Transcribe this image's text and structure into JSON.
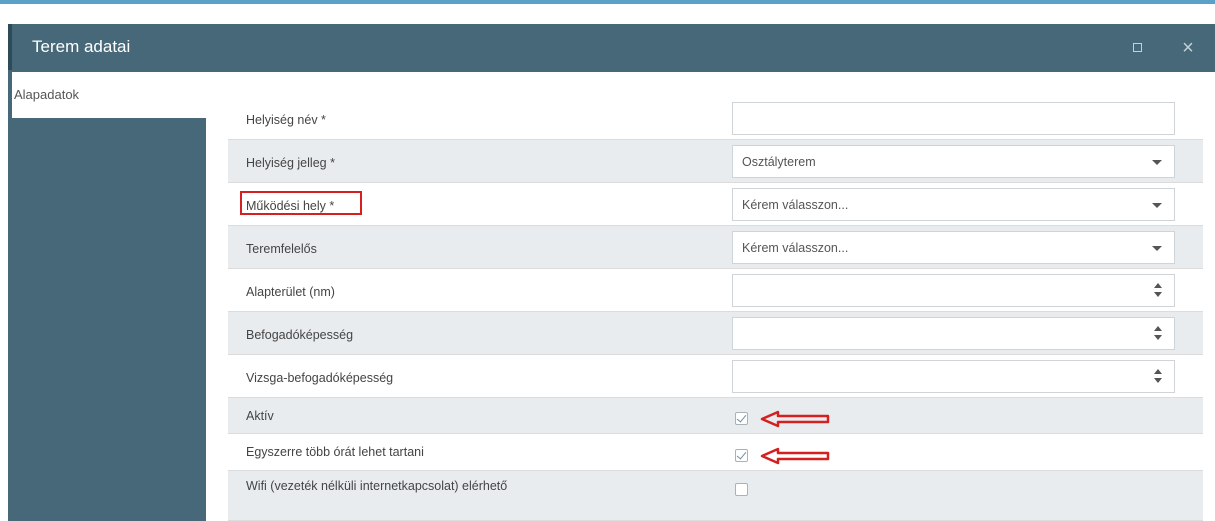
{
  "dialog": {
    "title": "Terem adatai",
    "maximize_icon": "maximize-icon",
    "close_icon": "close-icon",
    "close_glyph": "×"
  },
  "sidebar": {
    "items": [
      {
        "label": "Alapadatok",
        "active": true
      }
    ]
  },
  "form": {
    "fields": [
      {
        "label": "Helyiség név *",
        "type": "text",
        "value": ""
      },
      {
        "label": "Helyiség jelleg *",
        "type": "select",
        "value": "Osztályterem"
      },
      {
        "label": "Működési hely *",
        "type": "select",
        "value": "Kérem válasszon..."
      },
      {
        "label": "Teremfelelős",
        "type": "select",
        "value": "Kérem válasszon..."
      },
      {
        "label": "Alapterület (nm)",
        "type": "number",
        "value": ""
      },
      {
        "label": "Befogadóképesség",
        "type": "number",
        "value": ""
      },
      {
        "label": "Vizsga-befogadóképesség",
        "type": "number",
        "value": ""
      },
      {
        "label": "Aktív",
        "type": "checkbox",
        "checked": true
      },
      {
        "label": "Egyszerre több órát lehet tartani",
        "type": "checkbox",
        "checked": true
      },
      {
        "label": "Wifi (vezeték nélküli internetkapcsolat) elérhető",
        "type": "checkbox",
        "checked": false
      }
    ]
  },
  "colors": {
    "header": "#466878",
    "row_shaded": "#e9ecef",
    "annotation_red": "#d42020"
  }
}
